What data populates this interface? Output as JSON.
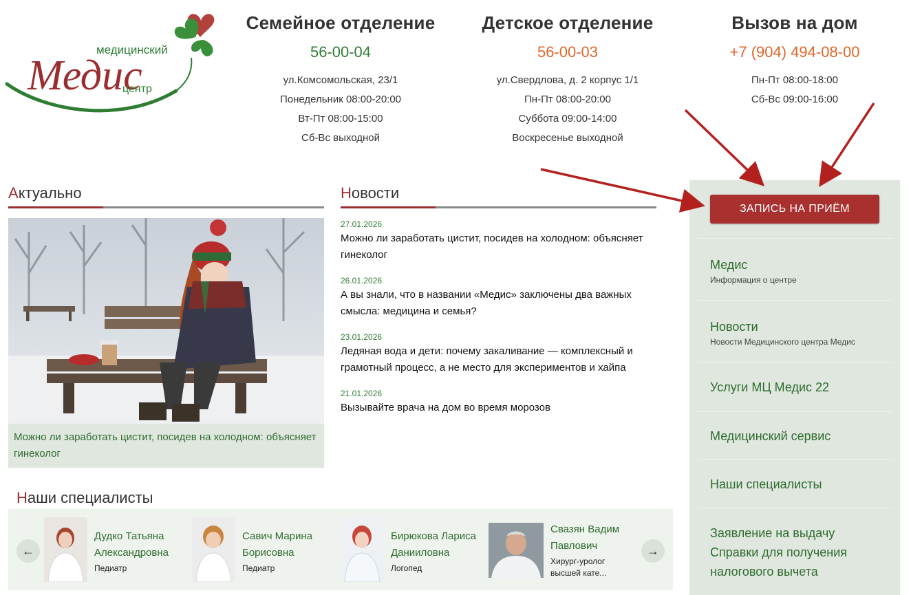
{
  "logo": {
    "word_top": "медицинский",
    "word_main": "Медис",
    "word_bottom": "центр"
  },
  "contacts": [
    {
      "title": "Семейное отделение",
      "phone": "56-00-04",
      "lines": [
        "ул.Комсомольская, 23/1",
        "Понедельник 08:00-20:00",
        "Вт-Пт 08:00-15:00",
        "Сб-Вс выходной"
      ]
    },
    {
      "title": "Детское отделение",
      "phone": "56-00-03",
      "lines": [
        "ул.Свердлова, д. 2 корпус 1/1",
        "Пн-Пт 08:00-20:00",
        "Суббота 09:00-14:00",
        "Воскресенье выходной"
      ]
    },
    {
      "title": "Вызов на дом",
      "phone": "+7 (904) 494-08-00",
      "lines": [
        "Пн-Пт 08:00-18:00",
        "Сб-Вс 09:00-16:00"
      ]
    }
  ],
  "sections": {
    "actual": {
      "first": "А",
      "rest": "ктуально"
    },
    "news": {
      "first": "Н",
      "rest": "овости"
    },
    "specialists": {
      "first": "Н",
      "rest": "аши специалисты"
    }
  },
  "feature": {
    "caption": "Можно ли заработать цистит, посидев на холодном: объясняет гинеколог"
  },
  "news": [
    {
      "date": "27.01.2026",
      "title": "Можно ли заработать цистит, посидев на холодном: объясняет гинеколог"
    },
    {
      "date": "26.01.2026",
      "title": "А вы знали, что в названии «Медис» заключены два важных смысла: медицина и семья?"
    },
    {
      "date": "23.01.2026",
      "title": "Ледяная вода и дети: почему закаливание — комплексный и грамотный процесс, а не место для экспериментов и хайпа"
    },
    {
      "date": "21.01.2026",
      "title": "Вызывайте врача на дом во время морозов"
    }
  ],
  "sidebar": {
    "cta": "ЗАПИСЬ НА ПРИЁМ",
    "items": [
      {
        "label": "Медис",
        "sub": "Информация о центре"
      },
      {
        "label": "Новости",
        "sub": "Новости Медицинского центра Медис"
      },
      {
        "label": "Услуги МЦ Медис 22",
        "sub": ""
      },
      {
        "label": "Медицинский сервис",
        "sub": ""
      },
      {
        "label": "Наши специалисты",
        "sub": ""
      },
      {
        "label": "Заявление на выдачу Справки для получения налогового вычета",
        "sub": ""
      }
    ]
  },
  "specialists": {
    "prev": "←",
    "next": "→",
    "items": [
      {
        "name": "Дудко Татьяна Александровна",
        "role": "Педиатр"
      },
      {
        "name": "Савич Марина Борисовна",
        "role": "Педиатр"
      },
      {
        "name": "Бирюкова Лариса Данииловна",
        "role": "Логопед"
      },
      {
        "name": "Свазян Вадим Павлович",
        "role": "Хирург-уролог высшей кате..."
      }
    ]
  },
  "colors": {
    "accent_red": "#a8312f",
    "brand_green": "#2e7d32",
    "phone_orange": "#e0662a",
    "panel_green": "#dfe7df"
  }
}
